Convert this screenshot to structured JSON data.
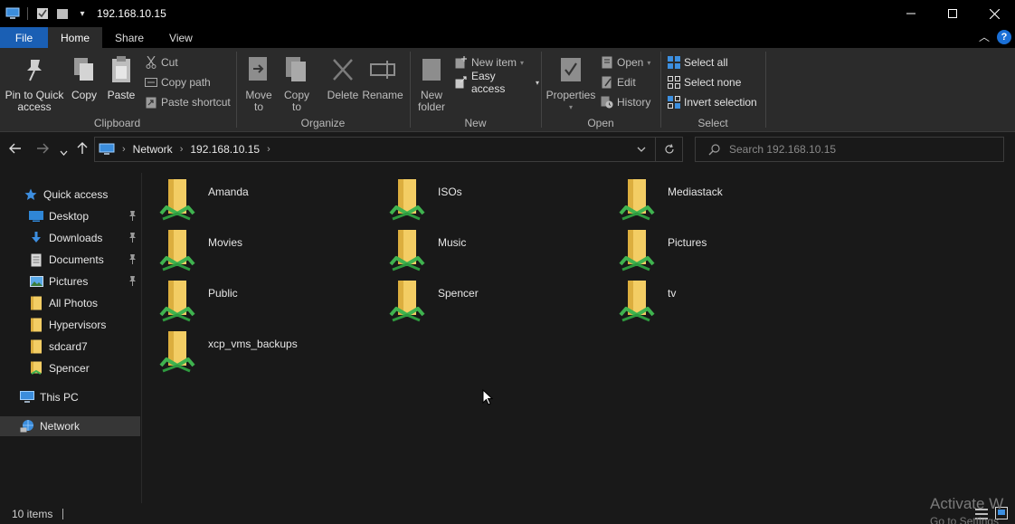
{
  "titlebar": {
    "address_title": "192.168.10.15",
    "controls": [
      "minimize",
      "maximize",
      "close"
    ]
  },
  "ribbon_tabs": [
    {
      "label": "File"
    },
    {
      "label": "Home"
    },
    {
      "label": "Share"
    },
    {
      "label": "View"
    }
  ],
  "ribbon": {
    "clipboard": {
      "group_label": "Clipboard",
      "pin_line1": "Pin to Quick",
      "pin_line2": "access",
      "copy": "Copy",
      "paste": "Paste",
      "cut": "Cut",
      "copy_path": "Copy path",
      "paste_shortcut": "Paste shortcut"
    },
    "organize": {
      "group_label": "Organize",
      "move_to_line1": "Move",
      "move_to_line2": "to",
      "copy_to_line1": "Copy",
      "copy_to_line2": "to",
      "delete": "Delete",
      "rename": "Rename"
    },
    "new": {
      "group_label": "New",
      "new_folder_line1": "New",
      "new_folder_line2": "folder",
      "new_item": "New item",
      "easy_access": "Easy access"
    },
    "open": {
      "group_label": "Open",
      "properties": "Properties",
      "open": "Open",
      "edit": "Edit",
      "history": "History"
    },
    "select": {
      "group_label": "Select",
      "select_all": "Select all",
      "select_none": "Select none",
      "invert_selection": "Invert selection"
    }
  },
  "address_bar": {
    "crumbs": [
      "Network",
      "192.168.10.15"
    ],
    "search_placeholder": "Search 192.168.10.15"
  },
  "nav_pane": {
    "quick_access": "Quick access",
    "items": [
      {
        "label": "Desktop",
        "pinned": true
      },
      {
        "label": "Downloads",
        "pinned": true
      },
      {
        "label": "Documents",
        "pinned": true
      },
      {
        "label": "Pictures",
        "pinned": true
      },
      {
        "label": "All Photos",
        "pinned": false
      },
      {
        "label": "Hypervisors",
        "pinned": false
      },
      {
        "label": "sdcard7",
        "pinned": false
      },
      {
        "label": "Spencer",
        "pinned": false
      }
    ],
    "this_pc": "This PC",
    "network": "Network"
  },
  "folders": [
    {
      "name": "Amanda"
    },
    {
      "name": "ISOs"
    },
    {
      "name": "Mediastack"
    },
    {
      "name": "Movies"
    },
    {
      "name": "Music"
    },
    {
      "name": "Pictures"
    },
    {
      "name": "Public"
    },
    {
      "name": "Spencer"
    },
    {
      "name": "tv"
    },
    {
      "name": "xcp_vms_backups"
    }
  ],
  "status": {
    "item_count": "10 items"
  },
  "watermark": {
    "line1": "Activate W",
    "line2": "Go to Settings"
  },
  "colors": {
    "accent": "#1a5fb4",
    "folder": "#f3cd64",
    "share_green": "#3fb34f"
  }
}
